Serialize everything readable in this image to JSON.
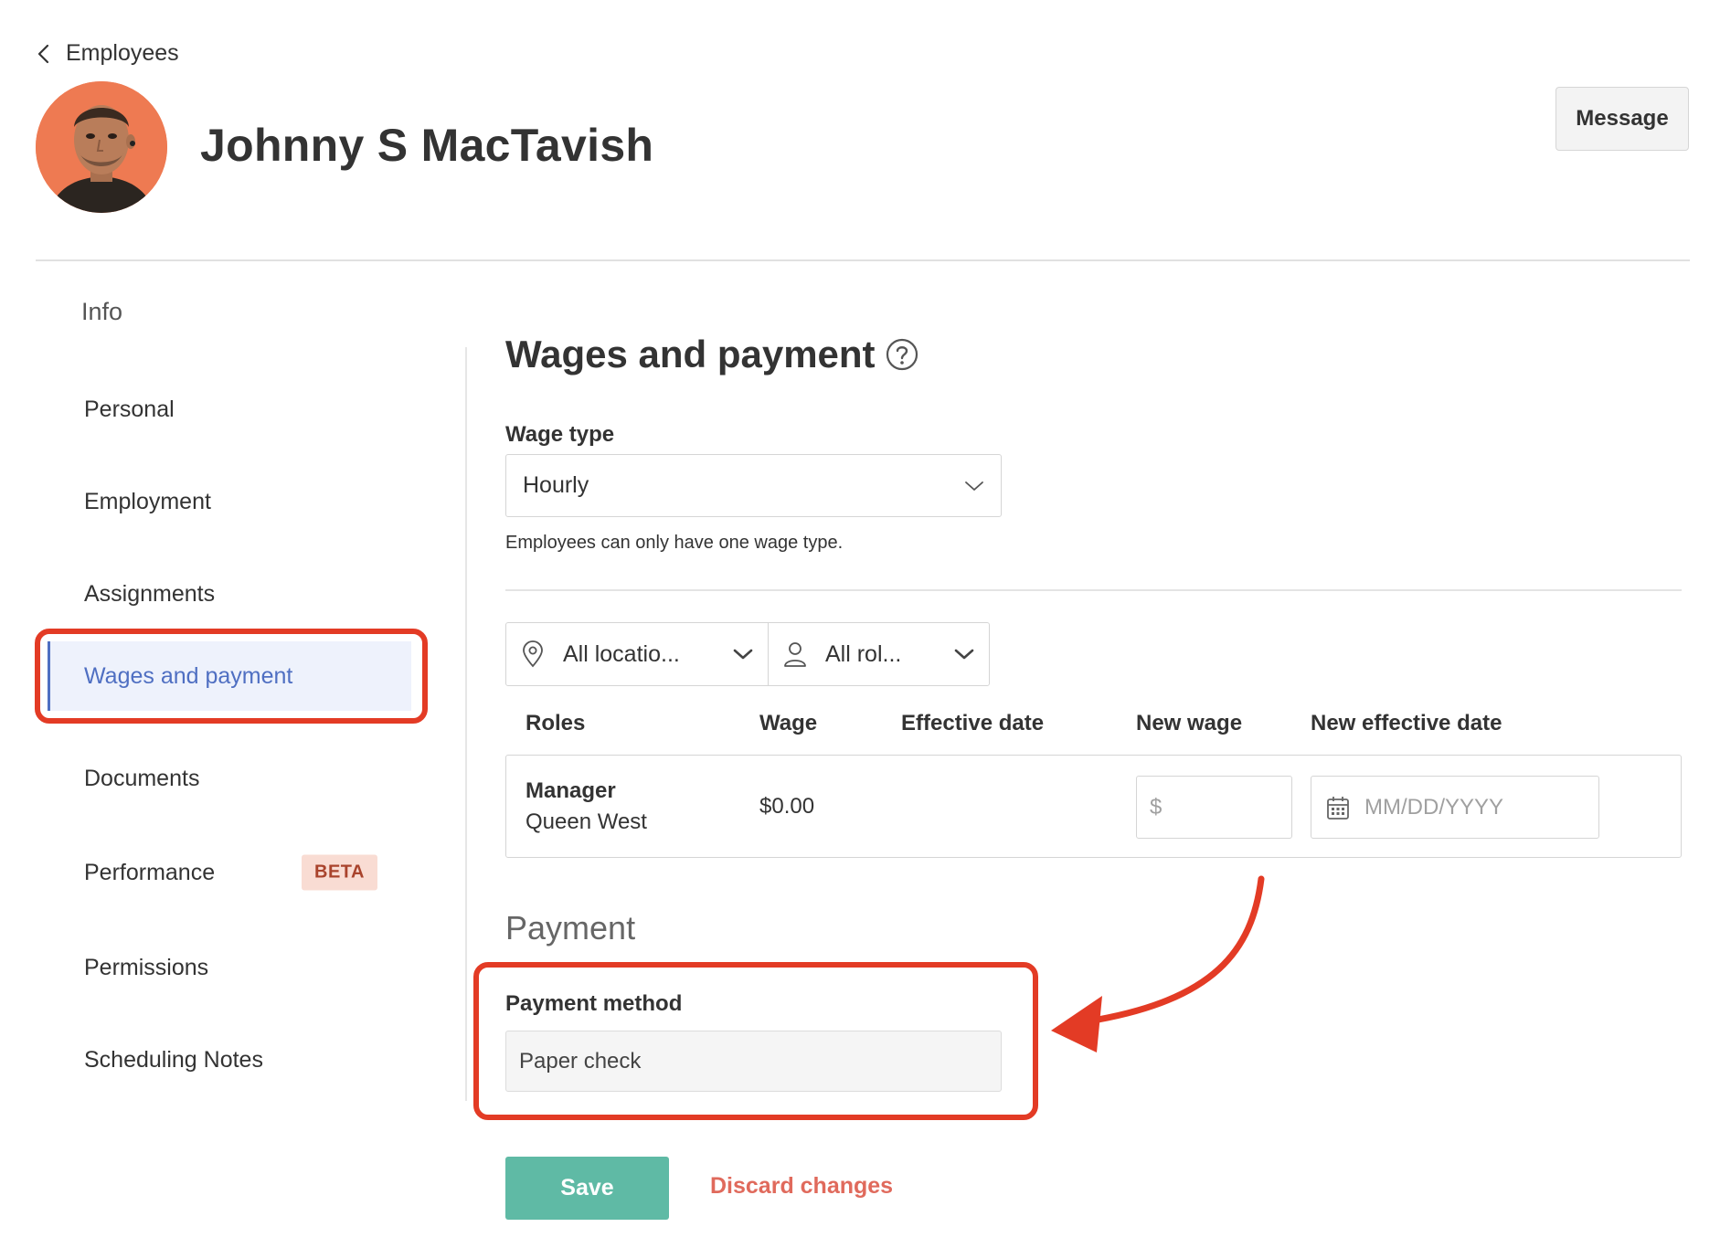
{
  "header": {
    "back_label": "Employees",
    "employee_name": "Johnny S MacTavish",
    "message_button": "Message"
  },
  "sidebar": {
    "heading": "Info",
    "items": [
      {
        "label": "Personal"
      },
      {
        "label": "Employment"
      },
      {
        "label": "Assignments"
      },
      {
        "label": "Wages and payment",
        "active": true
      },
      {
        "label": "Documents"
      },
      {
        "label": "Performance",
        "badge": "BETA"
      },
      {
        "label": "Permissions"
      },
      {
        "label": "Scheduling Notes"
      }
    ]
  },
  "wages": {
    "title": "Wages and payment",
    "wage_type_label": "Wage type",
    "wage_type_value": "Hourly",
    "wage_type_helper": "Employees can only have one wage type.",
    "filters": {
      "location": "All locatio...",
      "role": "All rol..."
    },
    "table": {
      "headers": [
        "Roles",
        "Wage",
        "Effective date",
        "New wage",
        "New effective date"
      ],
      "rows": [
        {
          "role": "Manager",
          "location": "Queen West",
          "wage": "$0.00",
          "effective_date": "",
          "new_wage_prefix": "$",
          "new_wage_value": "",
          "new_effective_date_placeholder": "MM/DD/YYYY"
        }
      ]
    }
  },
  "payment": {
    "heading": "Payment",
    "method_label": "Payment method",
    "method_value": "Paper check"
  },
  "actions": {
    "save": "Save",
    "discard": "Discard changes"
  },
  "colors": {
    "accent_blue": "#4f6fc2",
    "save_green": "#5fbaa5",
    "discard_red": "#e06a5c",
    "annotation_red": "#e33b25",
    "beta_bg": "#f9dcd3"
  }
}
